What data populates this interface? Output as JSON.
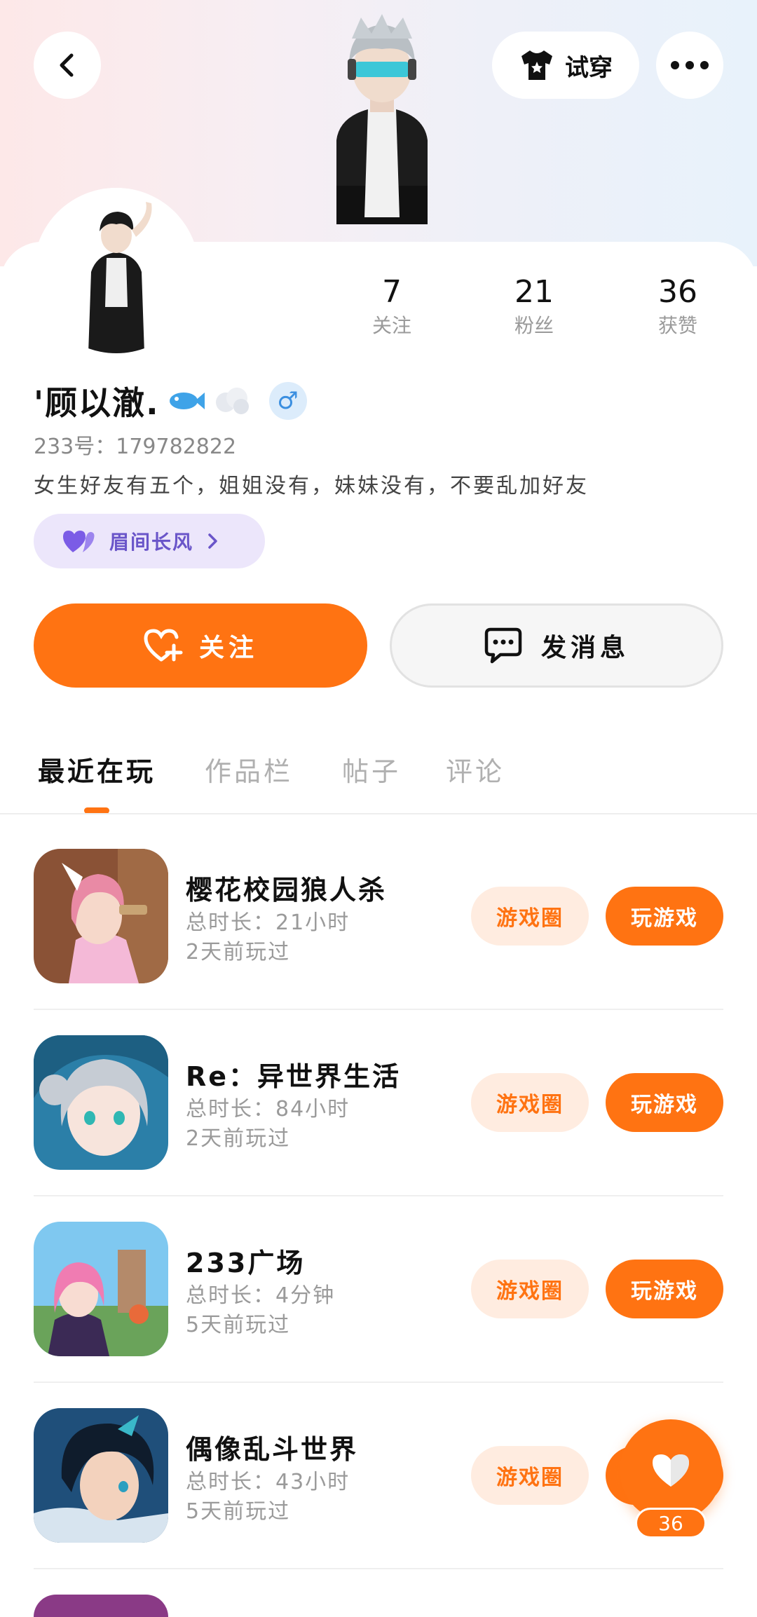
{
  "header": {
    "back_icon": "chevron-left-icon",
    "tryon_label": "试穿",
    "more_icon": "more-dots-icon"
  },
  "profile": {
    "stats": [
      {
        "value": "7",
        "label": "关注"
      },
      {
        "value": "21",
        "label": "粉丝"
      },
      {
        "value": "36",
        "label": "获赞"
      }
    ],
    "name": "'顾以澈.",
    "gender_symbol": "♂",
    "uid": "233号：179782822",
    "bio": "女生好友有五个，姐姐没有，妹妹没有，不要乱加好友",
    "tag_label": "眉间长风"
  },
  "actions": {
    "follow_label": "关注",
    "message_label": "发消息"
  },
  "tabs": [
    "最近在玩",
    "作品栏",
    "帖子",
    "评论"
  ],
  "games": [
    {
      "title": "樱花校园狼人杀",
      "duration": "总时长：21小时",
      "last_played": "2天前玩过",
      "circle_label": "游戏圈",
      "play_label": "玩游戏"
    },
    {
      "title": "Re：异世界生活",
      "duration": "总时长：84小时",
      "last_played": "2天前玩过",
      "circle_label": "游戏圈",
      "play_label": "玩游戏"
    },
    {
      "title": "233广场",
      "duration": "总时长：4分钟",
      "last_played": "5天前玩过",
      "circle_label": "游戏圈",
      "play_label": "玩游戏"
    },
    {
      "title": "偶像乱斗世界",
      "duration": "总时长：43小时",
      "last_played": "5天前玩过",
      "circle_label": "游戏圈",
      "play_label": "玩游戏"
    }
  ],
  "floating_like": {
    "count": "36",
    "icon": "heart-icon"
  },
  "colors": {
    "accent": "#ff7312",
    "accent_light": "#ffece0",
    "tag_bg": "#ece6fb",
    "tag_text": "#6a55c9",
    "gender_bg": "#dcecfb"
  }
}
